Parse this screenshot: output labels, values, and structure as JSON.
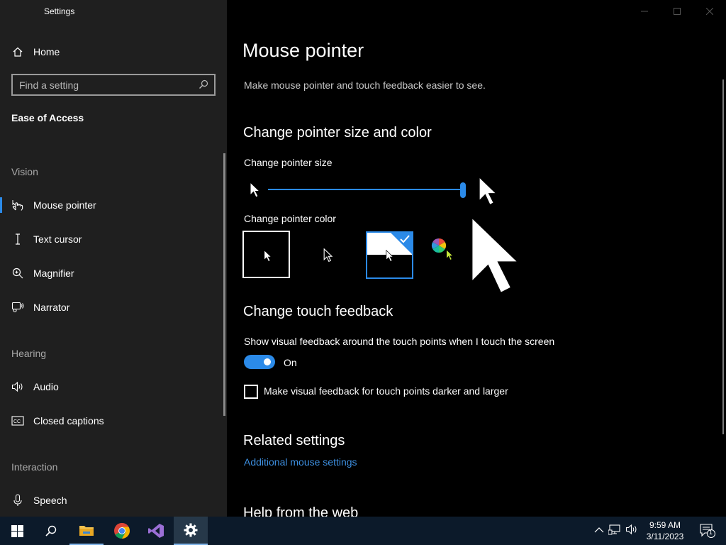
{
  "app": {
    "title": "Settings"
  },
  "sidebar": {
    "home": "Home",
    "search_placeholder": "Find a setting",
    "section": "Ease of Access",
    "groups": {
      "vision": "Vision",
      "hearing": "Hearing",
      "interaction": "Interaction"
    },
    "items": {
      "mouse_pointer": "Mouse pointer",
      "text_cursor": "Text cursor",
      "magnifier": "Magnifier",
      "narrator": "Narrator",
      "audio": "Audio",
      "closed_captions": "Closed captions",
      "speech": "Speech"
    },
    "active_item": "Mouse pointer",
    "accent_color": "#2b8ae8"
  },
  "main": {
    "title": "Mouse pointer",
    "description": "Make mouse pointer and touch feedback easier to see.",
    "pointer_section": {
      "heading": "Change pointer size and color",
      "size_label": "Change pointer size",
      "size_slider_level": 1.0,
      "color_label": "Change pointer color",
      "color_options": [
        "white",
        "black",
        "inverted",
        "custom"
      ],
      "selected_color": "inverted"
    },
    "touch_section": {
      "heading": "Change touch feedback",
      "toggle_label": "Show visual feedback around the touch points when I touch the screen",
      "toggle_state": "On",
      "checkbox_label": "Make visual feedback for touch points darker and larger",
      "checkbox_checked": false
    },
    "related": {
      "heading": "Related settings",
      "link": "Additional mouse settings"
    },
    "help": {
      "heading": "Help from the web"
    }
  },
  "taskbar": {
    "apps": [
      "windows-start-icon",
      "search-icon",
      "file-explorer-icon",
      "chrome-icon",
      "visual-studio-icon",
      "settings-gear-icon"
    ],
    "time": "9:59 AM",
    "date": "3/11/2023",
    "notification_count": "1"
  }
}
